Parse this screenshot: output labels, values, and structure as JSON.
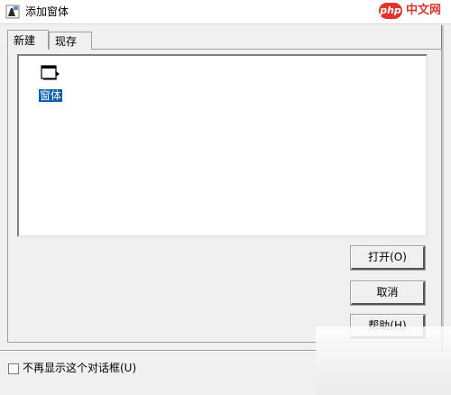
{
  "window": {
    "title": "添加窗体"
  },
  "watermark": {
    "logo": "php",
    "site": "中文网"
  },
  "tabs": [
    {
      "label": "新建"
    },
    {
      "label": "现存"
    }
  ],
  "list": {
    "items": [
      {
        "label": "窗体",
        "icon": "form-window-icon",
        "selected": true
      }
    ]
  },
  "buttons": {
    "open": "打开(O)",
    "cancel": "取消",
    "help": "帮助(H)"
  },
  "footer": {
    "checkbox_label": "不再显示这个对话框(U)",
    "checked": false
  },
  "colors": {
    "selection": "#0a5fa8",
    "face": "#f0f0f0"
  }
}
